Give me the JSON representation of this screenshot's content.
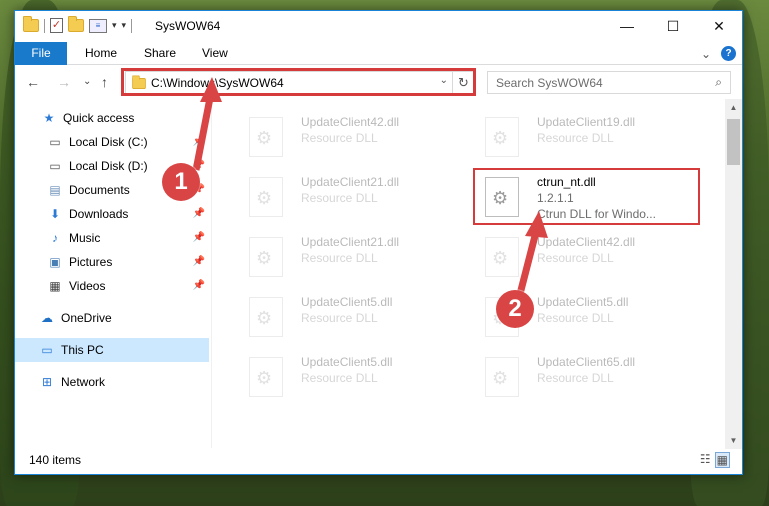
{
  "titlebar": {
    "title": "SysWOW64",
    "minimize": "—",
    "maximize": "☐",
    "close": "✕"
  },
  "ribbon": {
    "file": "File",
    "home": "Home",
    "share": "Share",
    "view": "View",
    "expand": "⌄",
    "help": "?"
  },
  "address": {
    "path": "C:\\Windows\\SysWOW64",
    "search_placeholder": "Search SysWOW64"
  },
  "nav": {
    "back": "←",
    "forward": "→",
    "recent": "⌄",
    "up": "↑"
  },
  "sidebar": {
    "items": [
      {
        "label": "Quick access",
        "icon": "star-icon"
      },
      {
        "label": "Local Disk (C:)",
        "icon": "drive-icon"
      },
      {
        "label": "Local Disk (D:)",
        "icon": "drive-icon"
      },
      {
        "label": "Documents",
        "icon": "documents-icon"
      },
      {
        "label": "Downloads",
        "icon": "downloads-icon"
      },
      {
        "label": "Music",
        "icon": "music-icon"
      },
      {
        "label": "Pictures",
        "icon": "pictures-icon"
      },
      {
        "label": "Videos",
        "icon": "videos-icon"
      },
      {
        "label": "OneDrive",
        "icon": "cloud-icon"
      },
      {
        "label": "This PC",
        "icon": "computer-icon"
      },
      {
        "label": "Network",
        "icon": "network-icon"
      }
    ]
  },
  "files": [
    {
      "name": "UpdateClient42.dll",
      "type": "Resource DLL"
    },
    {
      "name": "UpdateClient19.dll",
      "type": "Resource DLL"
    },
    {
      "name": "UpdateClient21.dll",
      "type": "Resource DLL"
    },
    {
      "name": "ctrun_nt.dll",
      "version": "1.2.1.1",
      "description": "Ctrun DLL for Windo..."
    },
    {
      "name": "UpdateClient21.dll",
      "type": "Resource DLL"
    },
    {
      "name": "UpdateClient42.dll",
      "type": "Resource DLL"
    },
    {
      "name": "UpdateClient5.dll",
      "type": "Resource DLL"
    },
    {
      "name": "UpdateClient5.dll",
      "type": "Resource DLL"
    },
    {
      "name": "UpdateClient5.dll",
      "type": "Resource DLL"
    },
    {
      "name": "UpdateClient65.dll",
      "type": "Resource DLL"
    }
  ],
  "status": {
    "count": "140 items"
  },
  "callouts": {
    "one": "1",
    "two": "2"
  },
  "colors": {
    "accent": "#1979ca",
    "highlight": "#d63b3b",
    "selected": "#cce8ff"
  }
}
